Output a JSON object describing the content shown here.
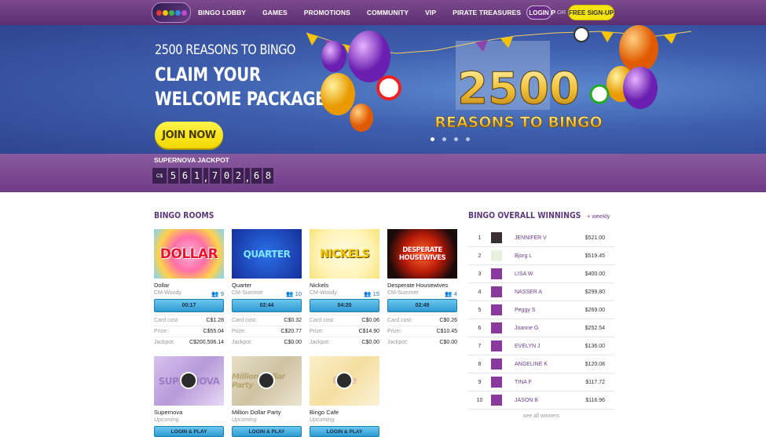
{
  "nav": {
    "items": [
      "BINGO LOBBY",
      "GAMES",
      "PROMOTIONS",
      "COMMUNITY",
      "VIP",
      "PIRATE TREASURES",
      "HELP"
    ],
    "login": "LOGIN",
    "or": "OR",
    "signup": "FREE SIGN-UP"
  },
  "hero": {
    "subtitle": "2500 REASONS TO BINGO",
    "title_line1": "CLAIM YOUR",
    "title_line2": "WELCOME PACKAGE",
    "cta": "JOIN NOW",
    "banner_number": "2500",
    "banner_text": "REASONS TO BINGO",
    "slides": 4,
    "active_slide": 0
  },
  "jackpot": {
    "label": "SUPERNOVA JACKPOT",
    "currency": "C$",
    "digits": [
      "5",
      "6",
      "1",
      ",",
      "7",
      "0",
      "2",
      ",",
      "6",
      "8"
    ]
  },
  "rooms_title": "BINGO ROOMS",
  "rooms": [
    {
      "name": "Dollar",
      "host": "CM-Woody",
      "players": "9",
      "timer": "00:17",
      "card_cost": "C$1.28",
      "prize": "C$55.04",
      "jackpot": "C$200,506.14",
      "thumb": "DOLLAR"
    },
    {
      "name": "Quarter",
      "host": "CM-Summer",
      "players": "10",
      "timer": "02:44",
      "card_cost": "C$0.32",
      "prize": "C$20.77",
      "jackpot": "C$0.00",
      "thumb": "QUARTER"
    },
    {
      "name": "Nickels",
      "host": "CM-Woody",
      "players": "15",
      "timer": "04:20",
      "card_cost": "C$0.06",
      "prize": "C$14.90",
      "jackpot": "C$0.00",
      "thumb": "NICKELS"
    },
    {
      "name": "Desperate Housewives",
      "host": "CM-Summer",
      "players": "4",
      "timer": "02:49",
      "card_cost": "C$0.26",
      "prize": "C$10.45",
      "jackpot": "C$0.00",
      "thumb": "DESPERATE HOUSEWIVES"
    }
  ],
  "labels": {
    "card_cost": "Card cost:",
    "prize": "Prize:",
    "jackpot": "Jackpot:"
  },
  "upcoming_rooms": [
    {
      "name": "Supernova",
      "status": "Upcoming",
      "button": "LOGIN & PLAY",
      "thumb": "SUPERNOVA"
    },
    {
      "name": "Million Dollar Party",
      "status": "Upcoming",
      "button": "LOGIN & PLAY",
      "thumb": "Million Dollar Party"
    },
    {
      "name": "Bingo Cafe",
      "status": "Upcoming",
      "button": "LOGIN & PLAY",
      "thumb": "Cafe"
    }
  ],
  "winnings": {
    "title": "BINGO OVERALL WINNINGS",
    "period": "+ weekly",
    "see_all": "see all winners",
    "rows": [
      {
        "rank": "1",
        "name": "JENNIFER V",
        "amount": "$521.00"
      },
      {
        "rank": "2",
        "name": "Bjorg L",
        "amount": "$519.45"
      },
      {
        "rank": "3",
        "name": "LISA W",
        "amount": "$400.00"
      },
      {
        "rank": "4",
        "name": "NASSER A",
        "amount": "$299.80"
      },
      {
        "rank": "5",
        "name": "Peggy S",
        "amount": "$269.00"
      },
      {
        "rank": "6",
        "name": "Joanne G",
        "amount": "$252.54"
      },
      {
        "rank": "7",
        "name": "EVELYN J",
        "amount": "$136.00"
      },
      {
        "rank": "8",
        "name": "ANGELINE K",
        "amount": "$120.08"
      },
      {
        "rank": "9",
        "name": "TINA F",
        "amount": "$117.72"
      },
      {
        "rank": "10",
        "name": "JASON B",
        "amount": "$116.96"
      }
    ]
  },
  "colors": {
    "nav": "#6a3a80",
    "hero": "#3e5fae",
    "accent": "#f6e40c",
    "timer": "#2e9bd3",
    "title": "#5c3a7a"
  }
}
